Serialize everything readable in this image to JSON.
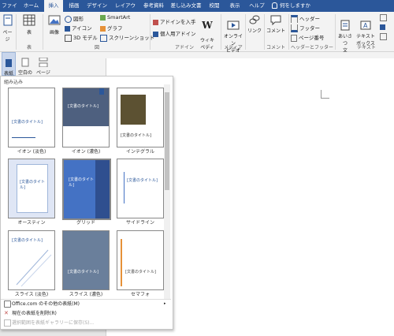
{
  "tabs": [
    "ファイル",
    "ホーム",
    "挿入",
    "描画",
    "デザイン",
    "レイアウト",
    "参考資料",
    "差し込み文書",
    "校閲",
    "表示",
    "ヘルプ"
  ],
  "tell_me": "何をしますか",
  "ribbon": {
    "page": "ページ",
    "table": "表",
    "image": "画像",
    "shapes": "図形",
    "icons": "アイコン",
    "model3d": "3D モデル",
    "smartart": "SmartArt",
    "graph": "グラフ",
    "screenshot": "スクリーンショット",
    "addin_get": "アドインを入手",
    "addin_personal": "個人用アドイン",
    "wiki": "ウィキ\nペディア",
    "online_video": "オンライン\nビデオ",
    "link": "リンク",
    "comment": "コメント",
    "header": "ヘッダー",
    "footer": "フッター",
    "page_number": "ページ番号",
    "textbox": "テキスト\nボックス",
    "greeting": "あいさつ\n文",
    "groups": {
      "table": "表",
      "figure": "図",
      "addin": "アドイン",
      "media": "メディア",
      "comment": "コメント",
      "header_footer": "ヘッダーとフッター",
      "text": "テキスト"
    }
  },
  "page_group": {
    "cover": "表紙",
    "blank": "空白の\nページ",
    "break": "ページ\n区切り"
  },
  "dropdown": {
    "section": "組み込み",
    "covers": [
      {
        "name": "イオン (淡色)",
        "title": "[文書のタイトル]"
      },
      {
        "name": "イオン (濃色)",
        "title": "[文書のタイトル]"
      },
      {
        "name": "インテグラル",
        "title": "[文書のタイトル]"
      },
      {
        "name": "オースティン",
        "title": "[文書のタイトル]"
      },
      {
        "name": "グリッド",
        "title": "[文書のタイトル]"
      },
      {
        "name": "サイドライン",
        "title": "[文書のタイトル]"
      },
      {
        "name": "スライス (淡色)",
        "title": "[文書のタイトル]"
      },
      {
        "name": "スライス (濃色)",
        "title": "[文書のタイトル]"
      },
      {
        "name": "セマフォ",
        "title": "[文書のタイトル]"
      }
    ],
    "menu": [
      {
        "label": "Office.com のその他の表紙(M)",
        "enabled": true
      },
      {
        "label": "現在の表紙を削除(R)",
        "enabled": true
      },
      {
        "label": "選択範囲を表紙ギャラリーに保存(S)...",
        "enabled": false
      }
    ]
  },
  "colors": {
    "accent": "#2b579a",
    "blue": "#4472c4",
    "dark_blue": "#2f4f8f"
  }
}
